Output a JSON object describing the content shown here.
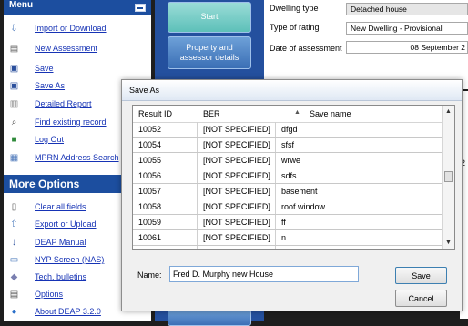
{
  "menu": {
    "title": "Menu",
    "items": [
      {
        "label": "Import or Download",
        "icon": "import-icon"
      },
      {
        "label": "New Assessment",
        "icon": "new-document-icon"
      },
      {
        "label": "Save",
        "icon": "save-icon"
      },
      {
        "label": "Save As",
        "icon": "save-as-icon"
      },
      {
        "label": "Detailed Report",
        "icon": "report-icon"
      },
      {
        "label": "Find existing record",
        "icon": "find-icon"
      },
      {
        "label": "Log Out",
        "icon": "logout-icon"
      },
      {
        "label": "MPRN Address Search",
        "icon": "address-search-icon"
      }
    ]
  },
  "more_options": {
    "title": "More Options",
    "items": [
      {
        "label": "Clear all fields",
        "icon": "clear-icon"
      },
      {
        "label": "Export or Upload",
        "icon": "export-icon"
      },
      {
        "label": "DEAP Manual",
        "icon": "manual-icon"
      },
      {
        "label": "NYP Screen (NAS)",
        "icon": "screen-icon"
      },
      {
        "label": "Tech. bulletins",
        "icon": "bulletin-icon"
      },
      {
        "label": "Options",
        "icon": "options-icon"
      },
      {
        "label": "About DEAP 3.2.0",
        "icon": "about-icon"
      }
    ]
  },
  "nav": {
    "start": "Start",
    "property_line1": "Property and",
    "property_line2": "assessor details"
  },
  "form": {
    "dwelling_type_label": "Dwelling type",
    "dwelling_type_value": "Detached house",
    "type_of_rating_label": "Type of rating",
    "type_of_rating_value": "New Dwelling - Provisional",
    "date_label": "Date of assessment",
    "date_value": "08 September 2"
  },
  "dialog": {
    "title": "Save As",
    "columns": [
      "Result ID",
      "BER",
      "Save name"
    ],
    "rows": [
      {
        "id": "10052",
        "ber": "[NOT SPECIFIED]",
        "name": "dfgd"
      },
      {
        "id": "10054",
        "ber": "[NOT SPECIFIED]",
        "name": "sfsf"
      },
      {
        "id": "10055",
        "ber": "[NOT SPECIFIED]",
        "name": "wrwe"
      },
      {
        "id": "10056",
        "ber": "[NOT SPECIFIED]",
        "name": "sdfs"
      },
      {
        "id": "10057",
        "ber": "[NOT SPECIFIED]",
        "name": "basement"
      },
      {
        "id": "10058",
        "ber": "[NOT SPECIFIED]",
        "name": "roof window"
      },
      {
        "id": "10059",
        "ber": "[NOT SPECIFIED]",
        "name": "ff"
      },
      {
        "id": "10061",
        "ber": "[NOT SPECIFIED]",
        "name": "n"
      }
    ],
    "name_label": "Name:",
    "name_value": "Fred D. Murphy new House",
    "save_label": "Save",
    "cancel_label": "Cancel"
  },
  "colors": {
    "menu_header": "#1c4e9f",
    "nav_column": "#24509e",
    "link": "#1633b5",
    "start_button": "#5dc0b9"
  }
}
